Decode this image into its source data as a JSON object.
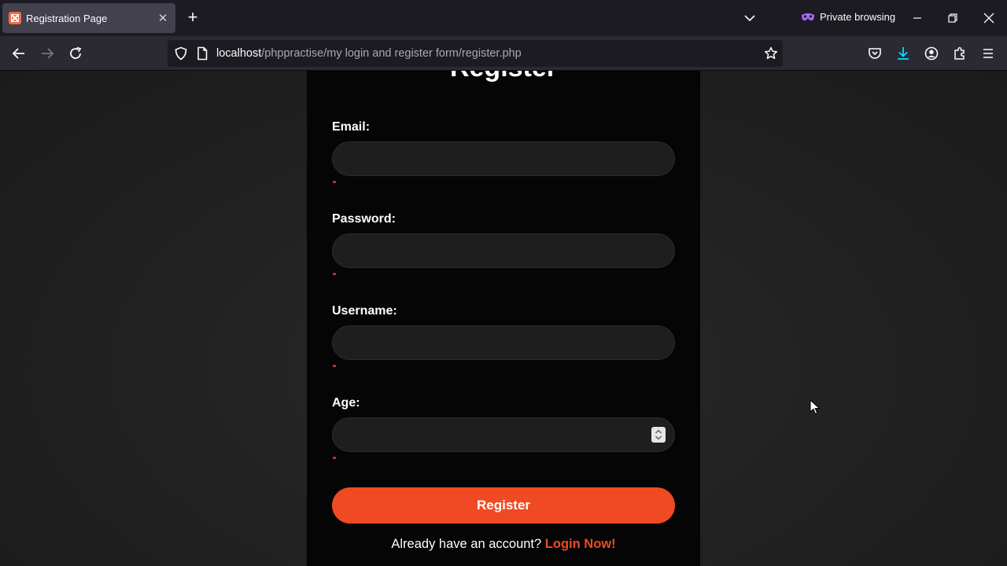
{
  "browser": {
    "tab": {
      "title": "Registration Page"
    },
    "private_label": "Private browsing",
    "url": {
      "host": "localhost",
      "path": "/phppractise/my login and register form/register.php"
    }
  },
  "form": {
    "title": "Register",
    "fields": [
      {
        "label": "Email:",
        "value": "",
        "type": "text"
      },
      {
        "label": "Password:",
        "value": "",
        "type": "password"
      },
      {
        "label": "Username:",
        "value": "",
        "type": "text"
      },
      {
        "label": "Age:",
        "value": "",
        "type": "number"
      }
    ],
    "submit_label": "Register",
    "login_prompt": "Already have an account?",
    "login_link": "Login Now!"
  },
  "colors": {
    "accent": "#ef4a23",
    "card_bg": "#050505",
    "page_bg": "#222222",
    "input_bg": "#1e1e1e",
    "required_marker": "#c0392b"
  }
}
